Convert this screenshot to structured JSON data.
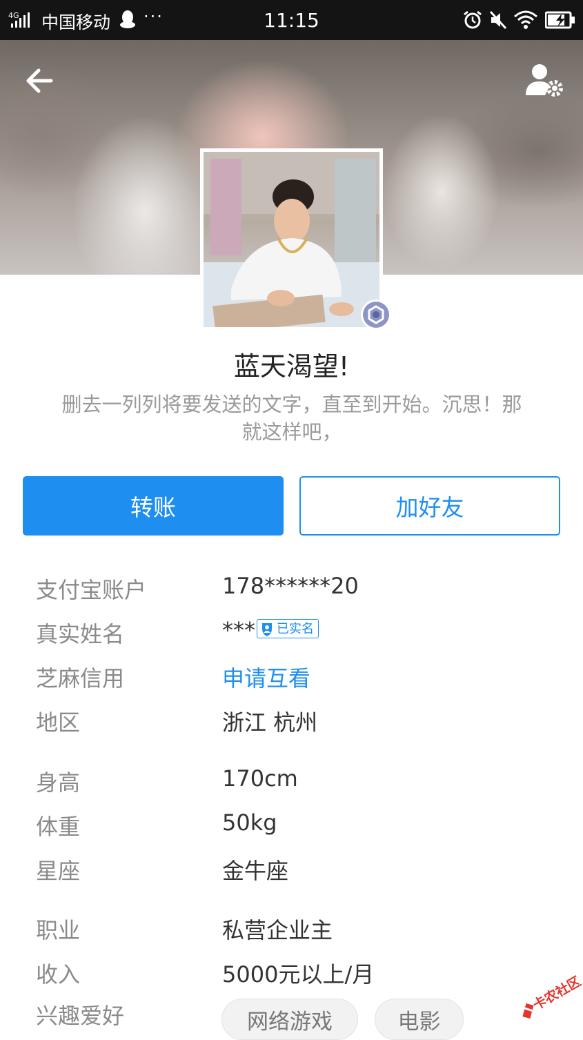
{
  "status_bar": {
    "network": "4G",
    "carrier": "中国移动",
    "more": "···",
    "time": "11:15"
  },
  "header": {
    "back_icon": "arrow-left-icon",
    "settings_icon": "user-settings-icon"
  },
  "profile": {
    "nickname": "蓝天渴望!",
    "signature": "删去一列列将要发送的文字，直至到开始。沉思！那就这样吧，",
    "badge_icon": "member-level-badge-icon"
  },
  "actions": {
    "transfer_label": "转账",
    "add_friend_label": "加好友"
  },
  "info": {
    "alipay_account": {
      "label": "支付宝账户",
      "value": "178******20"
    },
    "real_name": {
      "label": "真实姓名",
      "value": "***",
      "verified_label": "已实名"
    },
    "sesame_credit": {
      "label": "芝麻信用",
      "value": "申请互看"
    },
    "region": {
      "label": "地区",
      "value": "浙江 杭州"
    },
    "height": {
      "label": "身高",
      "value": "170cm"
    },
    "weight": {
      "label": "体重",
      "value": "50kg"
    },
    "zodiac": {
      "label": "星座",
      "value": "金牛座"
    },
    "occupation": {
      "label": "职业",
      "value": "私营企业主"
    },
    "income": {
      "label": "收入",
      "value": "5000元以上/月"
    },
    "hobbies": {
      "label": "兴趣爱好",
      "tags": [
        "网络游戏",
        "电影"
      ]
    }
  },
  "watermark": {
    "text": "卡农社区"
  },
  "colors": {
    "accent": "#1e8ff0",
    "label": "#8a8a8a",
    "status_bar": "#141414"
  }
}
